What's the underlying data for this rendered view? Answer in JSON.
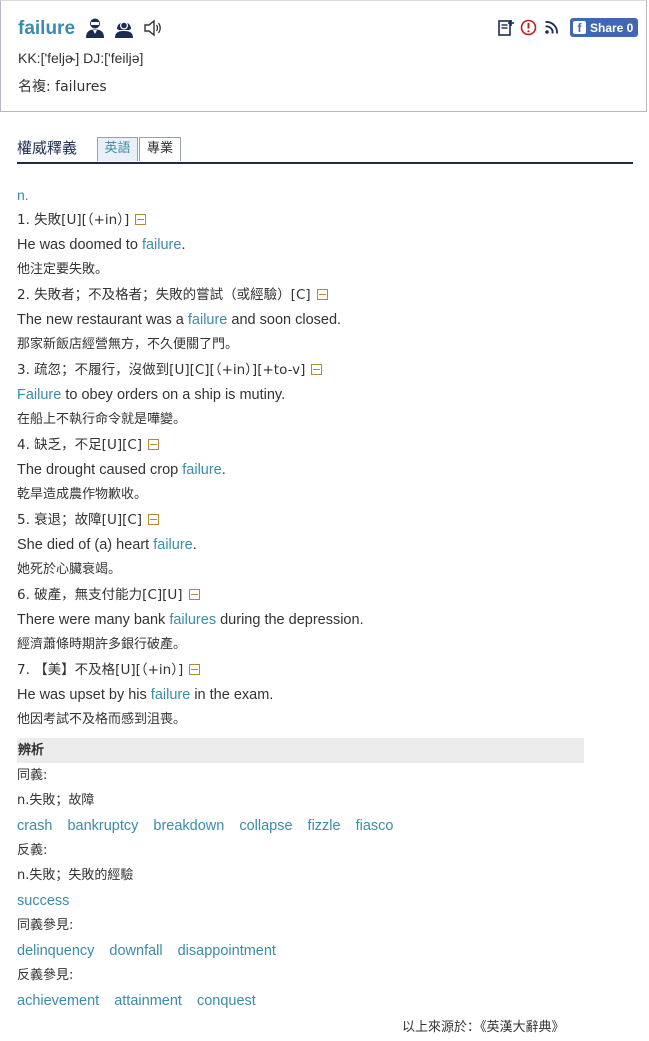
{
  "header": {
    "word": "failure",
    "pronunciation": "KK:['feljɚ] DJ:['feiljə]",
    "plural": "名複: failures",
    "icons": [
      "male-voice-icon",
      "female-voice-icon",
      "speaker-icon"
    ],
    "tools": [
      "wordbook-icon",
      "report-icon",
      "rss-icon"
    ],
    "share": {
      "label": "Share 0"
    }
  },
  "section": {
    "title": "權威釋義",
    "tabs": [
      "英語",
      "專業"
    ],
    "active_tab": "英語"
  },
  "entry": {
    "pos": "n.",
    "senses": [
      {
        "def": "1. 失敗[U][（+in）]",
        "ex_parts": [
          "He was doomed to ",
          "failure",
          "."
        ],
        "tr": "他注定要失敗。"
      },
      {
        "def": "2. 失敗者；不及格者；失敗的嘗試（或經驗）[C]",
        "ex_parts": [
          "The new restaurant was a ",
          "failure",
          " and soon closed."
        ],
        "tr": "那家新飯店經營無方，不久便關了門。"
      },
      {
        "def": "3. 疏忽；不履行，沒做到[U][C][（+in）][+to-v]",
        "ex_parts": [
          "",
          "Failure",
          " to obey orders on a ship is mutiny."
        ],
        "tr": "在船上不執行命令就是嘩變。"
      },
      {
        "def": "4. 缺乏，不足[U][C]",
        "ex_parts": [
          "The drought caused crop ",
          "failure",
          "."
        ],
        "tr": "乾旱造成農作物歉收。"
      },
      {
        "def": "5. 衰退；故障[U][C]",
        "ex_parts": [
          "She died of (a) heart ",
          "failure",
          "."
        ],
        "tr": "她死於心臟衰竭。"
      },
      {
        "def": "6. 破產，無支付能力[C][U]",
        "ex_parts": [
          "There were many bank ",
          "failures",
          " during the depression."
        ],
        "tr": "經濟蕭條時期許多銀行破產。"
      },
      {
        "def": "7. 【美】不及格[U][（+in）]",
        "ex_parts": [
          "He was upset by his ",
          "failure",
          " in the exam."
        ],
        "tr": "他因考試不及格而感到沮喪。"
      }
    ]
  },
  "analysis": {
    "title": "辨析",
    "synonym_label": "同義:",
    "synonym_sense": "n.失敗；故障",
    "synonyms": [
      "crash",
      "bankruptcy",
      "breakdown",
      "collapse",
      "fizzle",
      "fiasco"
    ],
    "antonym_label": "反義:",
    "antonym_sense": "n.失敗；失敗的經驗",
    "antonyms": [
      "success"
    ],
    "see_syn_label": "同義參見:",
    "see_syn": [
      "delinquency",
      "downfall",
      "disappointment"
    ],
    "see_ant_label": "反義參見:",
    "see_ant": [
      "achievement",
      "attainment",
      "conquest"
    ]
  },
  "source": "以上來源於：《英漢大辭典》",
  "colors": {
    "accent": "#3a8ca8",
    "navy": "#1b2c52",
    "facebook": "#4267b2",
    "collapse": "#b08a3a"
  }
}
